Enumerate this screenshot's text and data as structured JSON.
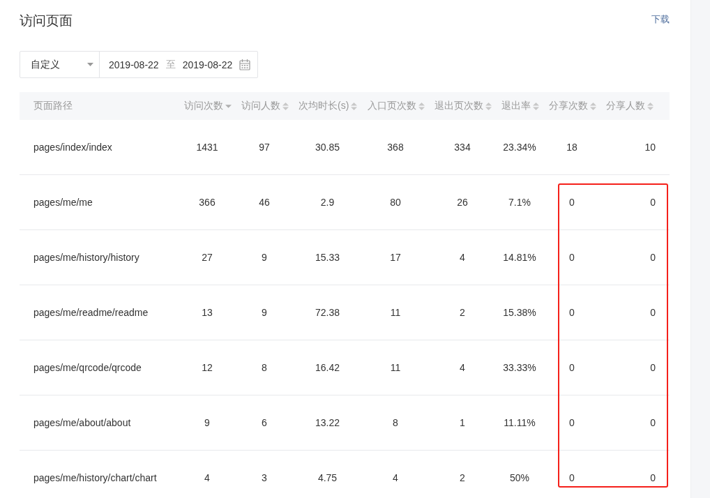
{
  "title": "访问页面",
  "download_link": "下载",
  "filter": {
    "range_select": "自定义",
    "start_date": "2019-08-22",
    "separator": "至",
    "end_date": "2019-08-22"
  },
  "table": {
    "columns": [
      {
        "label": "页面路径",
        "sortable": false
      },
      {
        "label": "访问次数",
        "sorted": true,
        "sortable": true
      },
      {
        "label": "访问人数",
        "sorted": false,
        "sortable": true
      },
      {
        "label": "次均时长(s)",
        "sorted": false,
        "sortable": true
      },
      {
        "label": "入口页次数",
        "sorted": false,
        "sortable": true
      },
      {
        "label": "退出页次数",
        "sorted": false,
        "sortable": true
      },
      {
        "label": "退出率",
        "sorted": false,
        "sortable": true
      },
      {
        "label": "分享次数",
        "sorted": false,
        "sortable": true
      },
      {
        "label": "分享人数",
        "sorted": false,
        "sortable": true
      }
    ],
    "rows": [
      [
        "pages/index/index",
        "1431",
        "97",
        "30.85",
        "368",
        "334",
        "23.34%",
        "18",
        "10"
      ],
      [
        "pages/me/me",
        "366",
        "46",
        "2.9",
        "80",
        "26",
        "7.1%",
        "0",
        "0"
      ],
      [
        "pages/me/history/history",
        "27",
        "9",
        "15.33",
        "17",
        "4",
        "14.81%",
        "0",
        "0"
      ],
      [
        "pages/me/readme/readme",
        "13",
        "9",
        "72.38",
        "11",
        "2",
        "15.38%",
        "0",
        "0"
      ],
      [
        "pages/me/qrcode/qrcode",
        "12",
        "8",
        "16.42",
        "11",
        "4",
        "33.33%",
        "0",
        "0"
      ],
      [
        "pages/me/about/about",
        "9",
        "6",
        "13.22",
        "8",
        "1",
        "11.11%",
        "0",
        "0"
      ],
      [
        "pages/me/history/chart/chart",
        "4",
        "3",
        "4.75",
        "4",
        "2",
        "50%",
        "0",
        "0"
      ]
    ]
  }
}
